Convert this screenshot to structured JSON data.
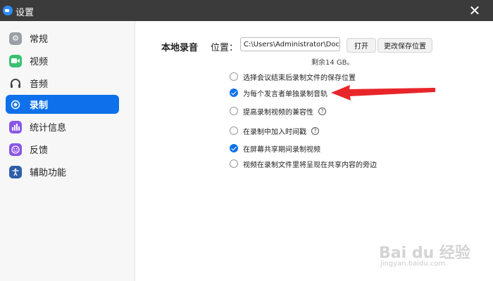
{
  "window": {
    "title": "设置"
  },
  "sidebar": {
    "items": [
      {
        "label": "常规",
        "icon": "gear-icon",
        "color": "#9aa0a6",
        "active": false
      },
      {
        "label": "视频",
        "icon": "video-camera-icon",
        "color": "#3ac171",
        "active": false
      },
      {
        "label": "音频",
        "icon": "headphones-icon",
        "color": "#444444",
        "active": false
      },
      {
        "label": "录制",
        "icon": "record-icon",
        "color": "#0e71eb",
        "active": true
      },
      {
        "label": "统计信息",
        "icon": "statistics-icon",
        "color": "#8a56e8",
        "active": false
      },
      {
        "label": "反馈",
        "icon": "feedback-icon",
        "color": "#8a56e8",
        "active": false
      },
      {
        "label": "辅助功能",
        "icon": "accessibility-icon",
        "color": "#2d5fa8",
        "active": false
      }
    ]
  },
  "recording": {
    "section_title": "本地录音",
    "location_label": "位置：",
    "path_value": "C:\\Users\\Administrator\\Docume",
    "open_label": "打开",
    "change_label": "更改保存位置",
    "remaining": "剩余14 GB。",
    "options": [
      {
        "label": "选择会议结束后录制文件的保存位置",
        "checked": false,
        "help": false
      },
      {
        "label": "为每个发言者单独录制音轨",
        "checked": true,
        "help": false
      },
      {
        "label": "提高录制视频的兼容性",
        "checked": false,
        "help": true
      },
      {
        "label": "在录制中加入时间戳",
        "checked": false,
        "help": true
      },
      {
        "label": "在屏幕共享期间录制视频",
        "checked": true,
        "help": false
      },
      {
        "label": "视频在录制文件里将呈现在共享内容的旁边",
        "checked": false,
        "help": false
      }
    ]
  },
  "watermark": {
    "main": "Bai du 经验",
    "sub": "jingyan.baidu.com"
  },
  "colors": {
    "accent": "#0e71eb",
    "arrow": "#e8252a",
    "titlebar": "#3b3b3b"
  }
}
